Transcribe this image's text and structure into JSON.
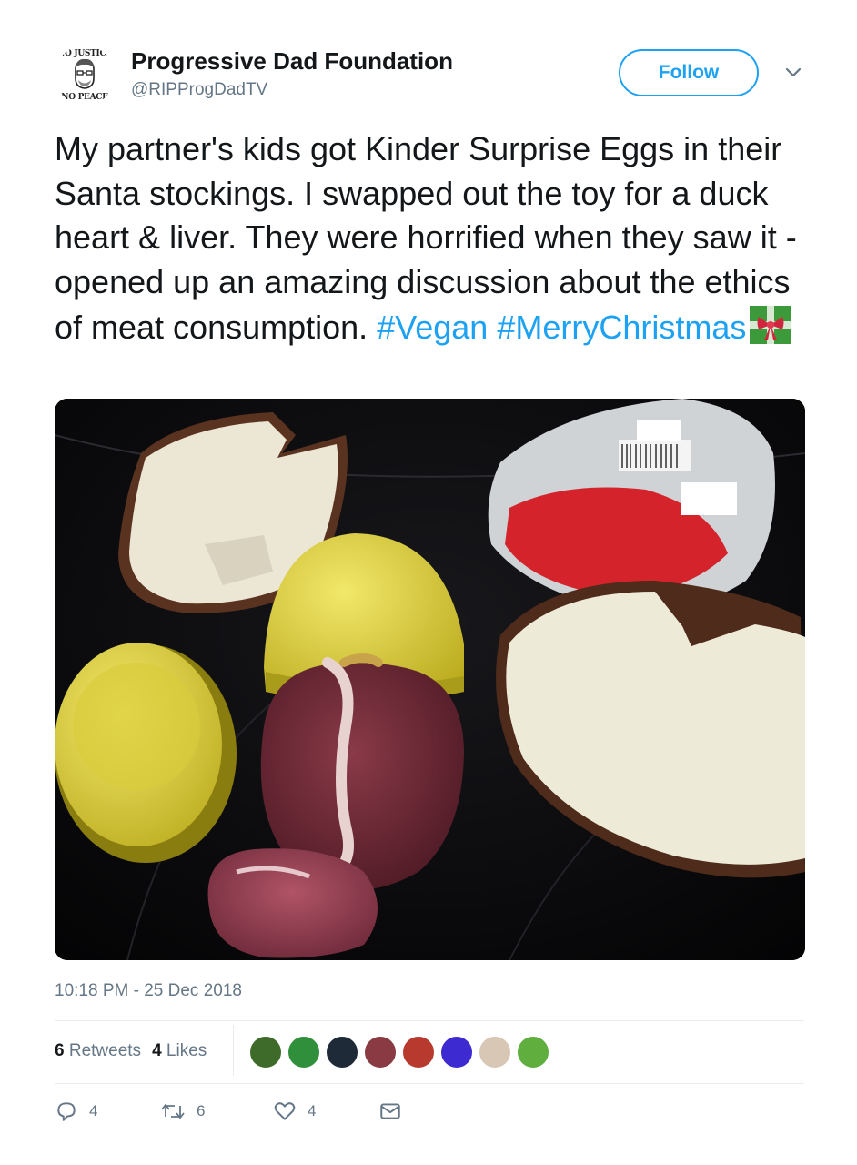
{
  "account": {
    "avatar_text_top": "NO JUSTICE",
    "avatar_text_bottom": "NO PEACE",
    "display_name": "Progressive Dad Foundation",
    "handle": "@RIPProgDadTV",
    "follow_label": "Follow"
  },
  "tweet": {
    "text_plain": "My partner's kids got Kinder Surprise Eggs in their Santa stockings. I swapped out the toy for a duck heart & liver. They were horrified when they saw it - opened up an amazing discussion about the ethics of meat consumption.",
    "hashtag_1": "#Vegan",
    "hashtag_2": "#MerryChristmas",
    "emoji": "gift-emoji"
  },
  "meta": {
    "timestamp": "10:18 PM - 25 Dec 2018"
  },
  "stats": {
    "retweets_count": "6",
    "retweets_label": "Retweets",
    "likes_count": "4",
    "likes_label": "Likes"
  },
  "liker_avatars": [
    {
      "name": "liker-avatar-1",
      "color": "#3e6b2a"
    },
    {
      "name": "liker-avatar-2",
      "color": "#2f8f3a"
    },
    {
      "name": "liker-avatar-3",
      "color": "#1f2a38"
    },
    {
      "name": "liker-avatar-4",
      "color": "#8a3a42"
    },
    {
      "name": "liker-avatar-5",
      "color": "#b83a2f"
    },
    {
      "name": "liker-avatar-6",
      "color": "#3d2ad0"
    },
    {
      "name": "liker-avatar-7",
      "color": "#d8c7b5"
    },
    {
      "name": "liker-avatar-8",
      "color": "#5fae3e"
    }
  ],
  "actions": {
    "reply_count": "4",
    "retweet_count": "6",
    "like_count": "4"
  },
  "colors": {
    "accent": "#1da1f2",
    "secondary_text": "#657786",
    "primary_text": "#14171a"
  }
}
